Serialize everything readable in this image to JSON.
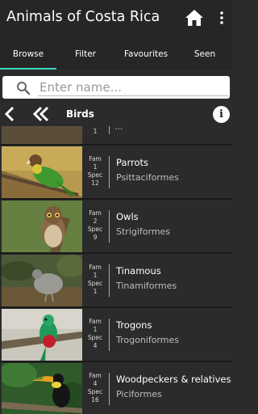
{
  "app": {
    "title": "Animals of Costa Rica",
    "home_icon": "home-icon",
    "menu_icon": "more-vert-icon"
  },
  "tabs": [
    {
      "label": "Browse",
      "active": true
    },
    {
      "label": "Filter"
    },
    {
      "label": "Favourites"
    },
    {
      "label": "Seen"
    }
  ],
  "colors": {
    "accent": "#3dd7c2",
    "bar": "#262626",
    "background": "#2b2b2b"
  },
  "search": {
    "placeholder": "Enter name..."
  },
  "nav": {
    "title": "Birds"
  },
  "list": {
    "partial_top": {
      "spec": "1",
      "scientific": "..."
    },
    "groups": [
      {
        "fam_label": "Fam",
        "fam": "1",
        "spec_label": "Spec",
        "spec": "12",
        "common": "Parrots",
        "scientific": "Psittaciformes",
        "image": "parrot"
      },
      {
        "fam_label": "Fam",
        "fam": "2",
        "spec_label": "Spec",
        "spec": "9",
        "common": "Owls",
        "scientific": "Strigiformes",
        "image": "owl"
      },
      {
        "fam_label": "Fam",
        "fam": "1",
        "spec_label": "Spec",
        "spec": "1",
        "common": "Tinamous",
        "scientific": "Tinamiformes",
        "image": "tinamou"
      },
      {
        "fam_label": "Fam",
        "fam": "1",
        "spec_label": "Spec",
        "spec": "4",
        "common": "Trogons",
        "scientific": "Trogoniformes",
        "image": "quetzal"
      },
      {
        "fam_label": "Fam",
        "fam": "4",
        "spec_label": "Spec",
        "spec": "16",
        "common": "Woodpeckers & relatives",
        "scientific": "Piciformes",
        "image": "toucan"
      }
    ]
  }
}
